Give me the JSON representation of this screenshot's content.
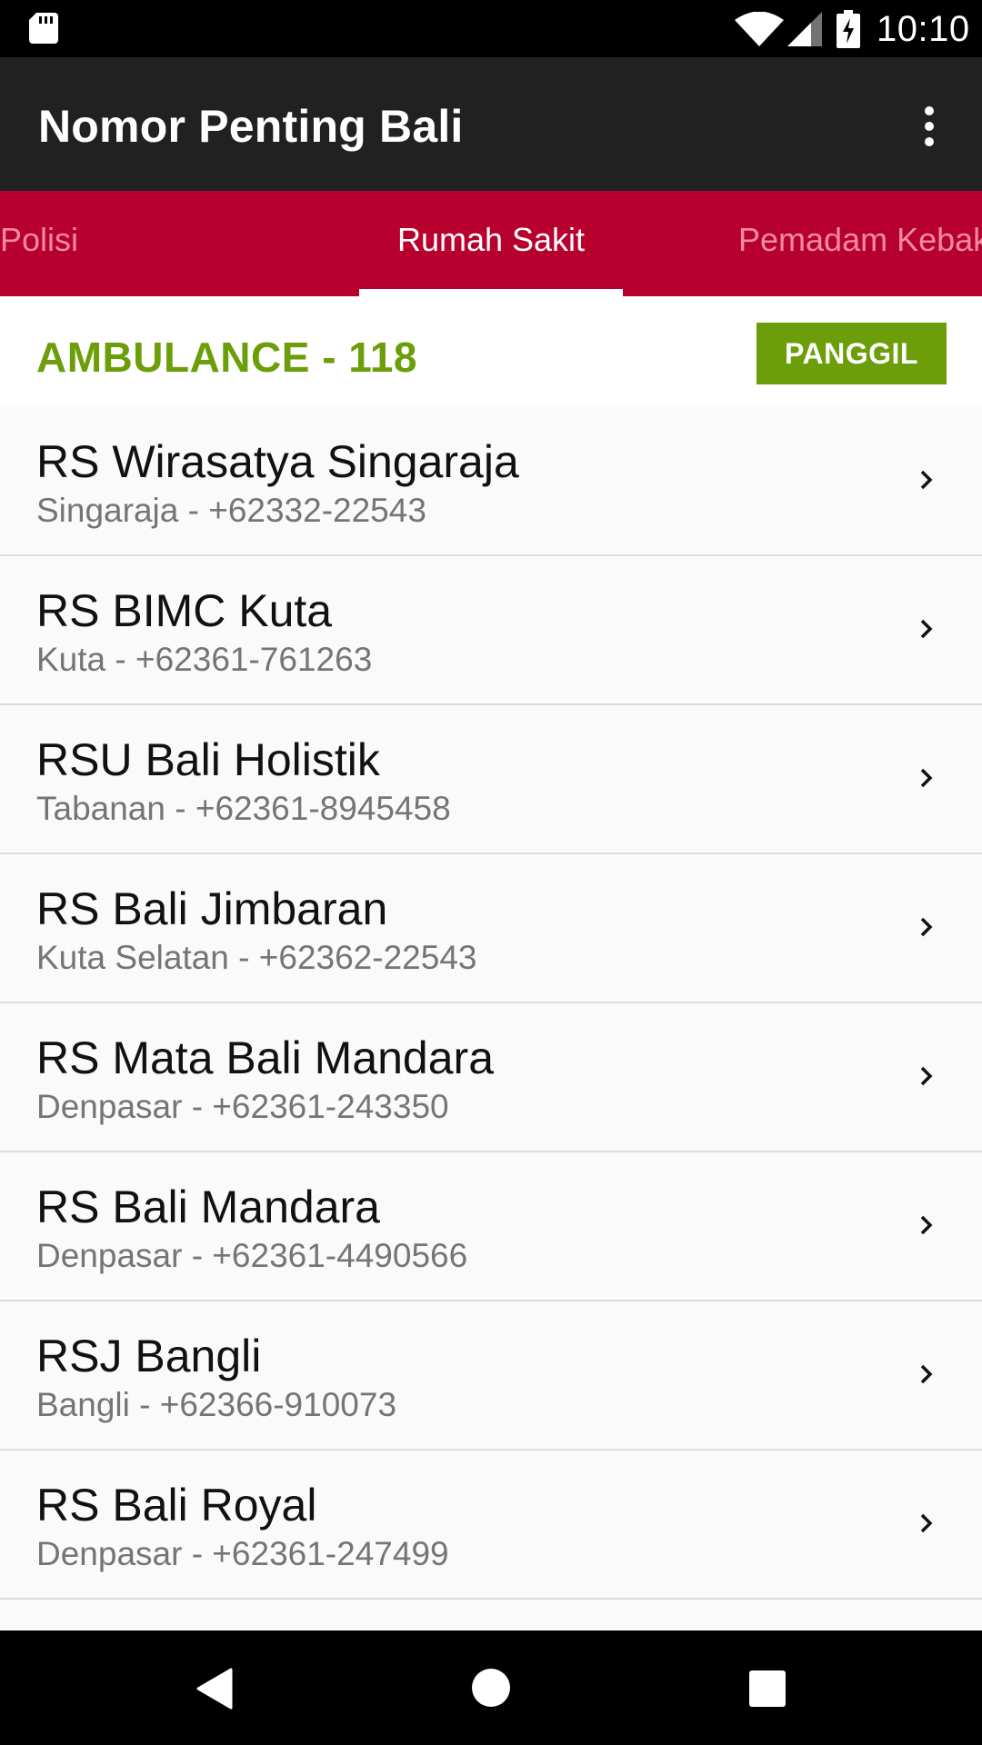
{
  "status_bar": {
    "time": "10:10",
    "icons": [
      "sd-card-icon",
      "wifi-icon",
      "signal-icon",
      "battery-charging-icon"
    ]
  },
  "app_bar": {
    "title": "Nomor Penting Bali",
    "menu_icon": "more-vert-icon"
  },
  "tabs": [
    {
      "label": "Polisi",
      "selected": false
    },
    {
      "label": "Rumah Sakit",
      "selected": true
    },
    {
      "label": "Pemadam Kebak",
      "selected": false
    }
  ],
  "ambulance": {
    "label": "AMBULANCE - 118",
    "button_label": "PANGGIL"
  },
  "hospitals": [
    {
      "name": "RS Wirasatya Singaraja",
      "detail": "Singaraja - +62332-22543"
    },
    {
      "name": "RS BIMC Kuta",
      "detail": "Kuta - +62361-761263"
    },
    {
      "name": "RSU Bali Holistik",
      "detail": "Tabanan - +62361-8945458"
    },
    {
      "name": "RS Bali Jimbaran",
      "detail": "Kuta Selatan - +62362-22543"
    },
    {
      "name": "RS Mata Bali Mandara",
      "detail": "Denpasar - +62361-243350"
    },
    {
      "name": "RS Bali Mandara",
      "detail": "Denpasar - +62361-4490566"
    },
    {
      "name": "RSJ Bangli",
      "detail": "Bangli - +62366-910073"
    },
    {
      "name": "RS Bali Royal",
      "detail": "Denpasar - +62361-247499"
    }
  ],
  "colors": {
    "app_bar": "#212121",
    "tab_bar": "#b8002f",
    "accent_green": "#6c9e0a",
    "list_background": "#fafafa"
  },
  "nav_bar": {
    "icons": [
      "back-icon",
      "home-icon",
      "recents-icon"
    ]
  }
}
